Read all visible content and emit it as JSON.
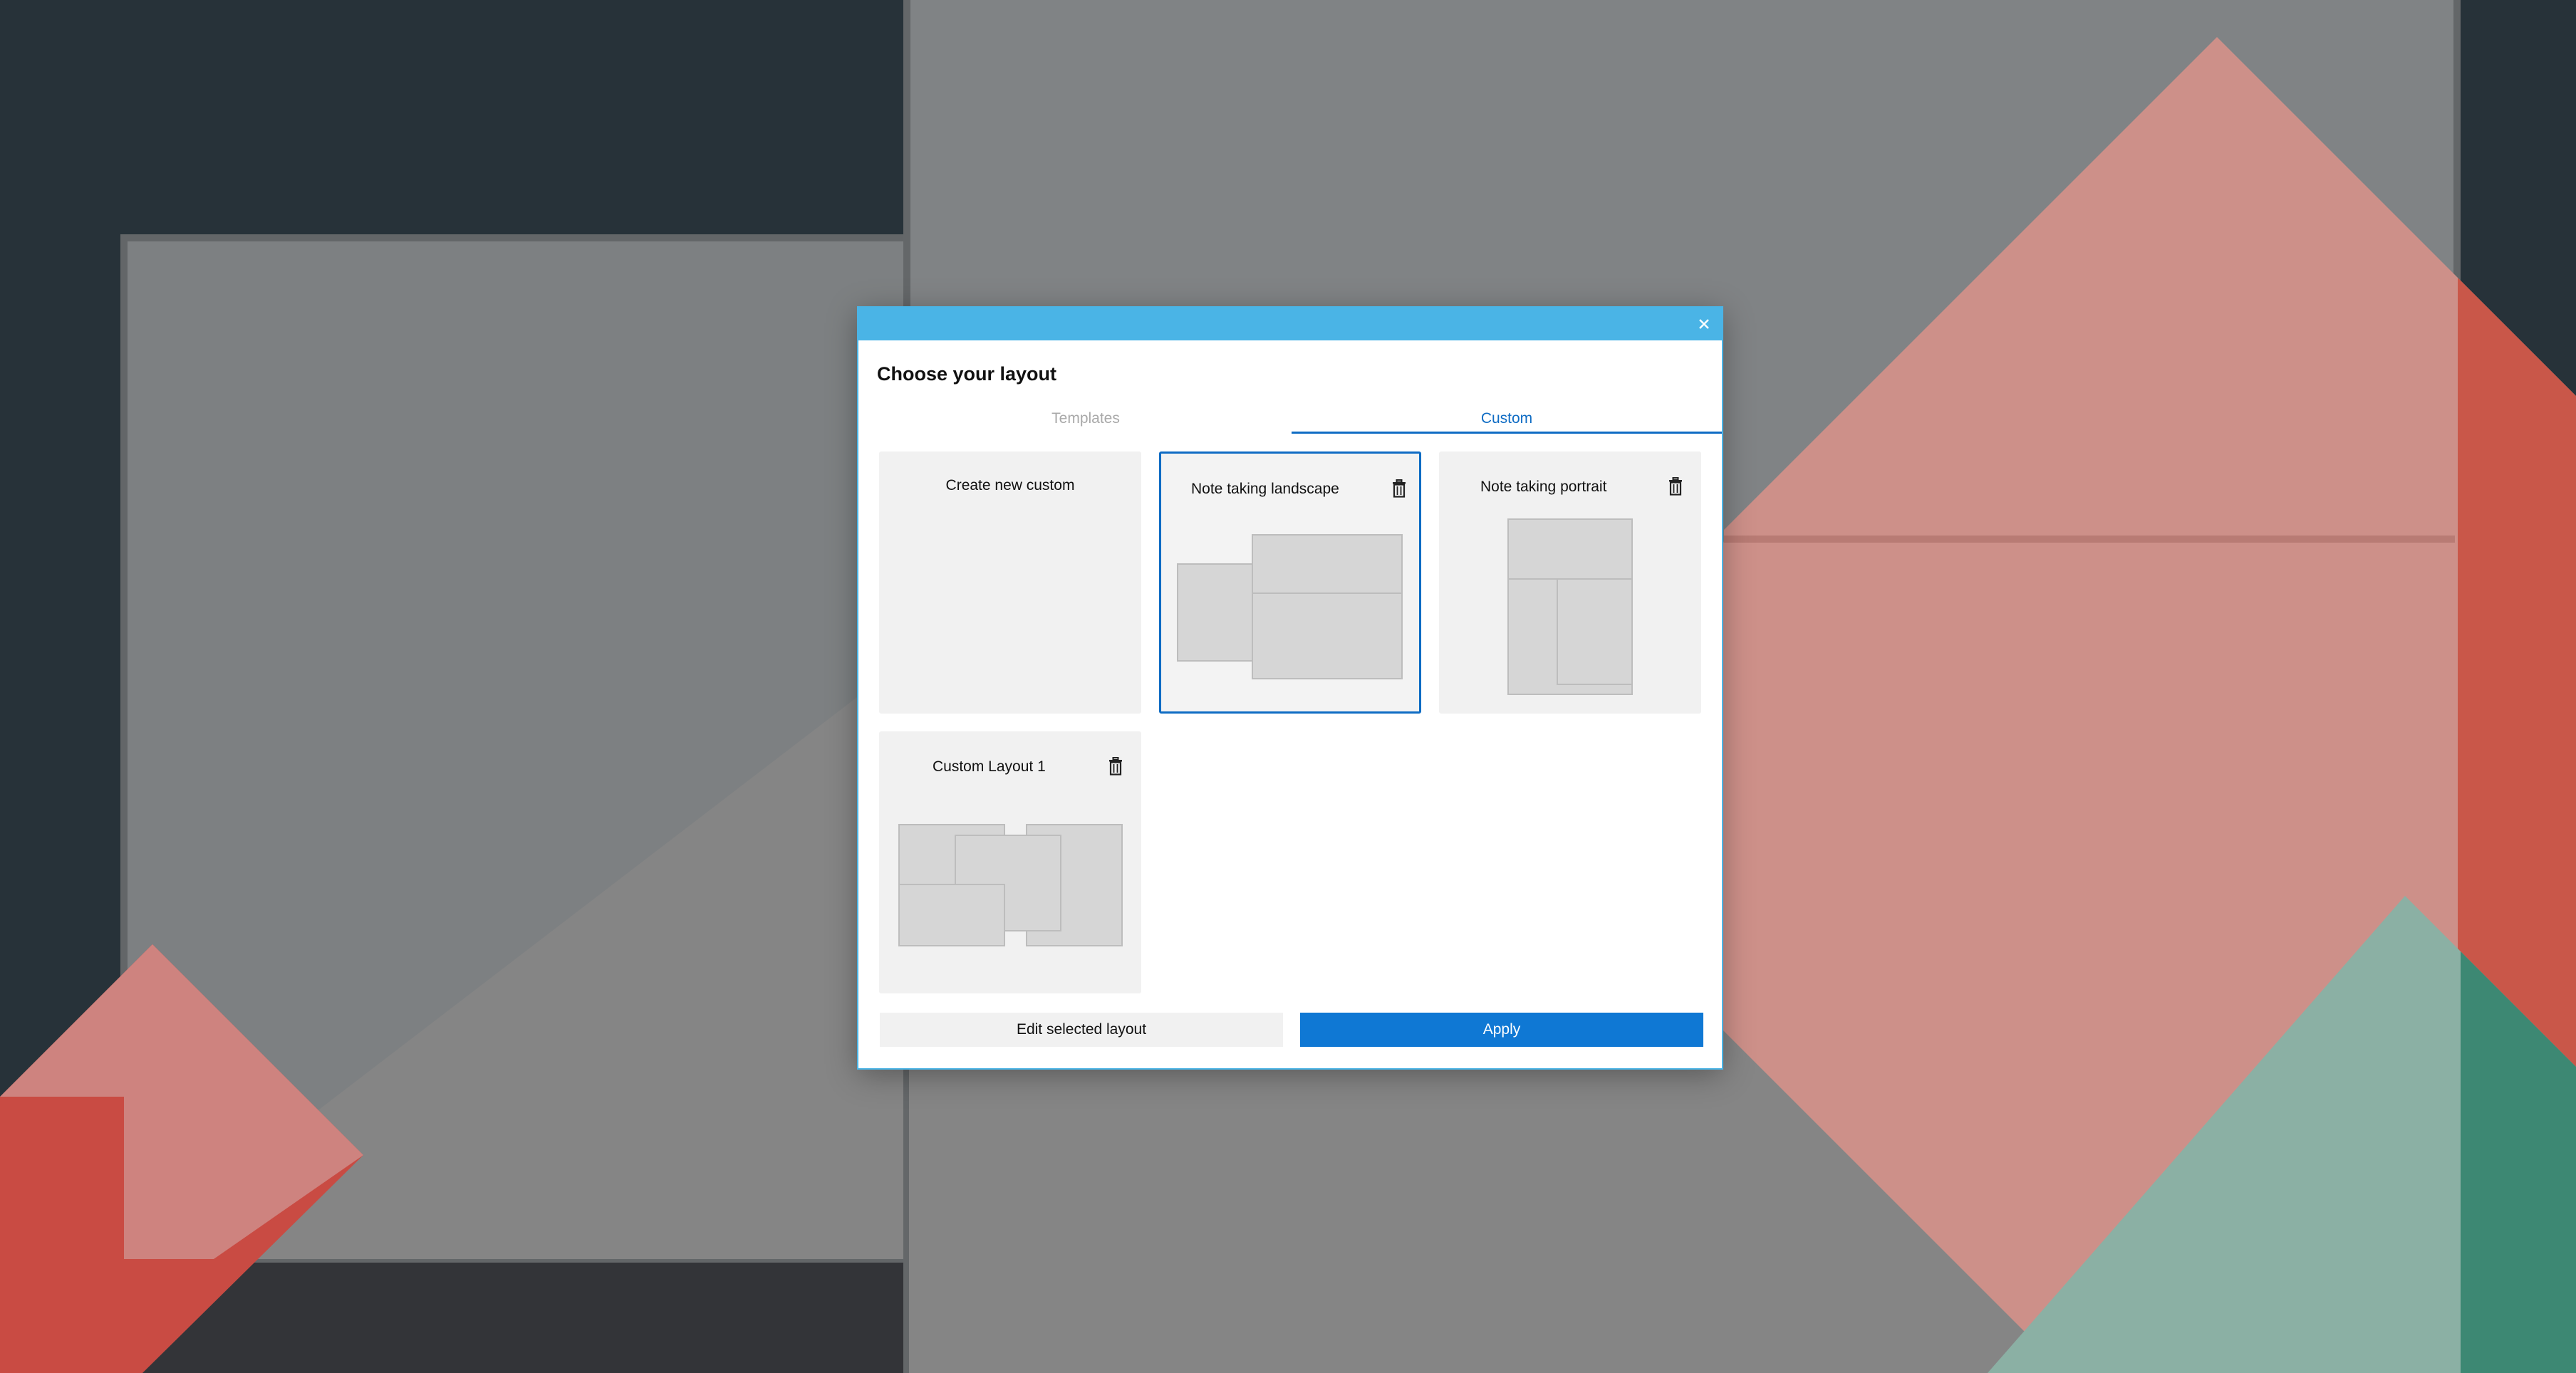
{
  "dialog": {
    "title": "Choose your layout",
    "close_icon": "close-icon",
    "tabs": [
      {
        "label": "Templates",
        "active": false
      },
      {
        "label": "Custom",
        "active": true
      }
    ],
    "cards": [
      {
        "title": "Create new custom",
        "selected": false,
        "deletable": false
      },
      {
        "title": "Note taking landscape",
        "selected": true,
        "deletable": true,
        "icon": "trash-icon"
      },
      {
        "title": "Note taking portrait",
        "selected": false,
        "deletable": true,
        "icon": "trash-icon"
      },
      {
        "title": "Custom Layout 1",
        "selected": false,
        "deletable": true,
        "icon": "trash-icon"
      }
    ],
    "buttons": {
      "edit": "Edit selected layout",
      "apply": "Apply"
    }
  },
  "colors": {
    "titlebar": "#4ab4e6",
    "accent": "#0f6cc4",
    "apply": "#0f78d4"
  }
}
